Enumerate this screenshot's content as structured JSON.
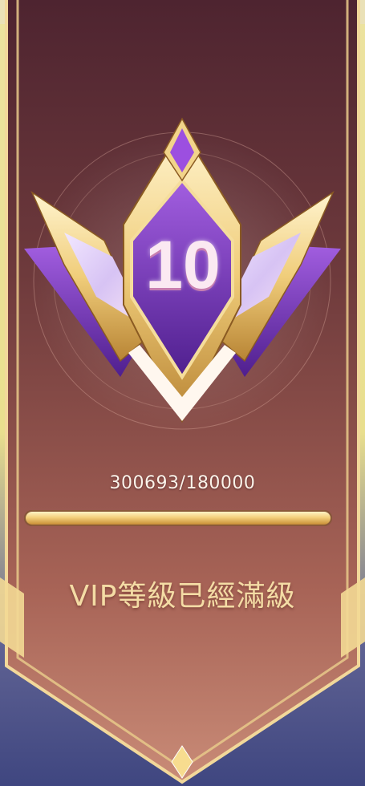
{
  "badge": {
    "level": "10"
  },
  "progress": {
    "text": "300693/180000",
    "fill_fraction": 1.0
  },
  "status": {
    "text": "VIP等級已經滿級"
  },
  "colors": {
    "banner_top": "#5a2c32",
    "banner_bottom": "#c47f72",
    "gold": "#f1d58a",
    "purple": "#7a3fb6",
    "bottom_blue": "#3f4680"
  }
}
